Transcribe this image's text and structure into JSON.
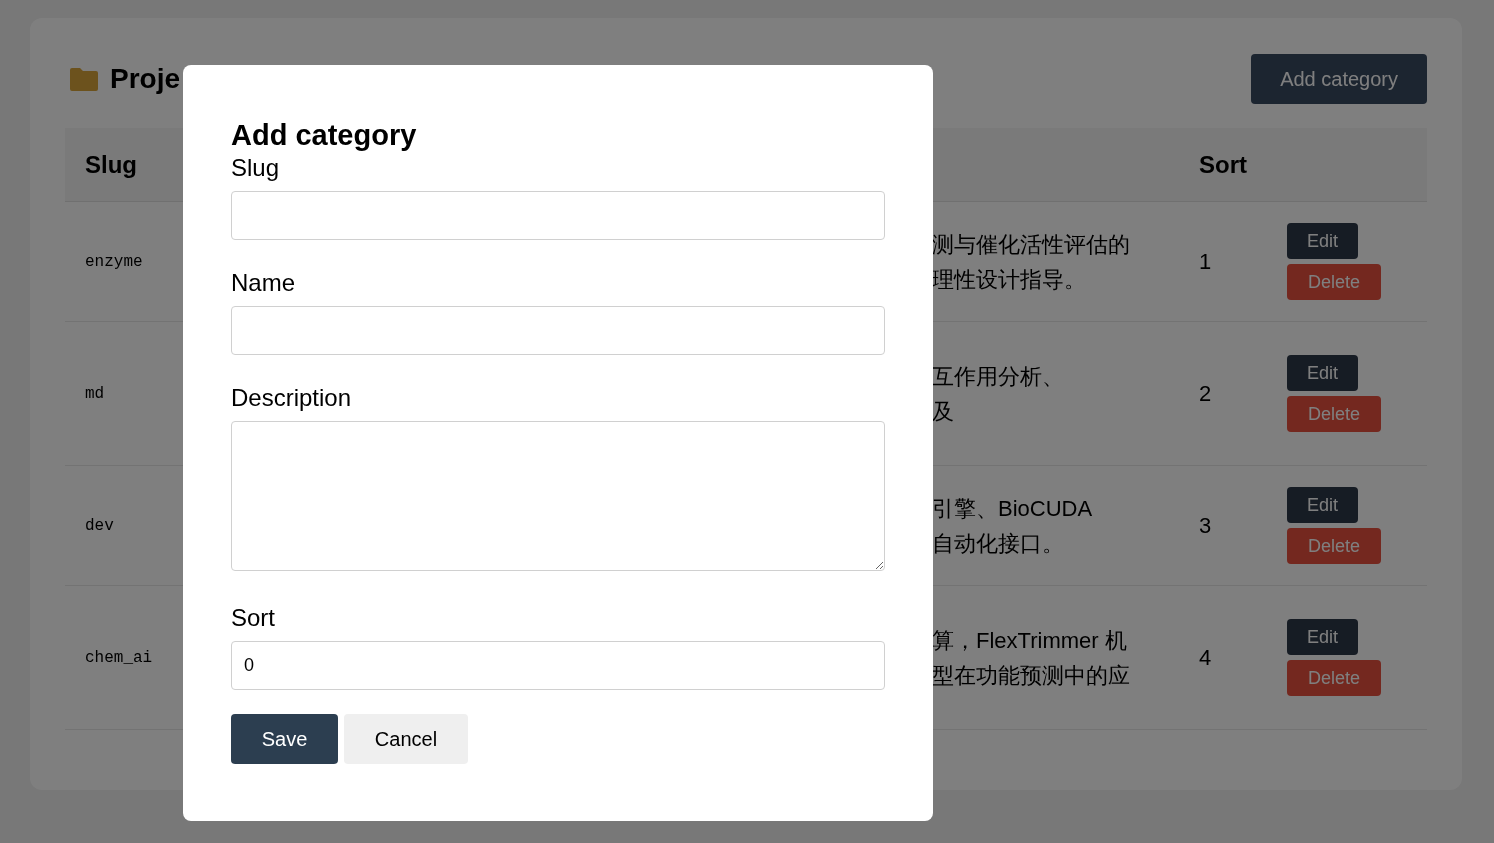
{
  "page": {
    "title": "Proje",
    "add_button": "Add category"
  },
  "table": {
    "columns": [
      "Slug",
      "Sort"
    ],
    "rows": [
      {
        "slug": "enzyme",
        "description": [
          "测与催化活性评估的",
          "理性设计指导。"
        ],
        "sort": "1",
        "actions": [
          {
            "label": "Edit",
            "kind": "edit"
          },
          {
            "label": "Delete",
            "kind": "delete"
          }
        ]
      },
      {
        "slug": "md",
        "description": [
          "互作用分析、",
          "及"
        ],
        "sort": "2",
        "actions": [
          {
            "label": "Edit",
            "kind": "edit"
          },
          {
            "label": "Delete",
            "kind": "delete"
          }
        ]
      },
      {
        "slug": "dev",
        "description": [
          "引擎、BioCUDA",
          "自动化接口。"
        ],
        "sort": "3",
        "actions": [
          {
            "label": "Edit",
            "kind": "edit"
          },
          {
            "label": "Delete",
            "kind": "delete"
          }
        ]
      },
      {
        "slug": "chem_ai",
        "description": [
          "算，FlexTrimmer 机",
          "型在功能预测中的应"
        ],
        "sort": "4",
        "actions": [
          {
            "label": "Edit",
            "kind": "edit"
          },
          {
            "label": "Delete",
            "kind": "delete"
          }
        ]
      }
    ]
  },
  "dialog": {
    "title": "Add category",
    "fields": [
      {
        "label": "Slug",
        "kind": "text"
      },
      {
        "label": "Name",
        "kind": "text"
      },
      {
        "label": "Description",
        "kind": "textarea"
      },
      {
        "label": "Sort",
        "kind": "text",
        "value": "0"
      }
    ],
    "buttons": [
      {
        "label": "Save",
        "kind": "primary"
      },
      {
        "label": "Cancel",
        "kind": "secondary"
      }
    ]
  }
}
